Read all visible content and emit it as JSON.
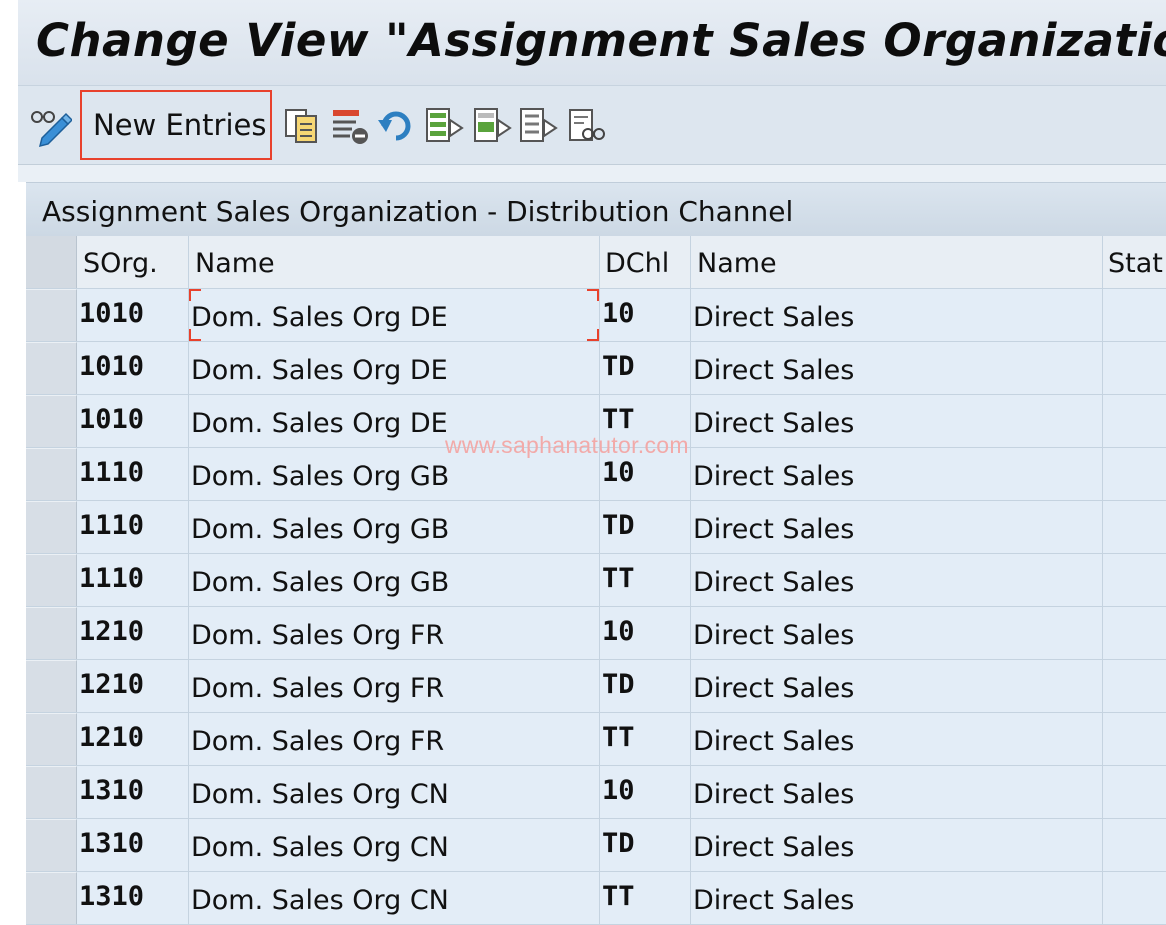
{
  "window": {
    "title": "Change View \"Assignment Sales Organization - Distribution Channel\": Overview"
  },
  "toolbar": {
    "new_entries_label": "New Entries",
    "icons": [
      "display-change-icon",
      "copy-as-icon",
      "delete-icon",
      "undo-change-icon",
      "select-all-icon",
      "select-block-icon",
      "deselect-all-icon",
      "print-icon"
    ]
  },
  "panel": {
    "title": "Assignment Sales Organization - Distribution Channel"
  },
  "table": {
    "columns": [
      "SOrg.",
      "Name",
      "DChl",
      "Name",
      "Stat"
    ],
    "rows": [
      {
        "sorg": "1010",
        "name": "Dom. Sales Org DE",
        "dchl": "10",
        "dname": "Direct Sales"
      },
      {
        "sorg": "1010",
        "name": "Dom. Sales Org DE",
        "dchl": "TD",
        "dname": "Direct Sales"
      },
      {
        "sorg": "1010",
        "name": "Dom. Sales Org DE",
        "dchl": "TT",
        "dname": "Direct Sales"
      },
      {
        "sorg": "1110",
        "name": "Dom. Sales Org GB",
        "dchl": "10",
        "dname": "Direct Sales"
      },
      {
        "sorg": "1110",
        "name": "Dom. Sales Org GB",
        "dchl": "TD",
        "dname": "Direct Sales"
      },
      {
        "sorg": "1110",
        "name": "Dom. Sales Org GB",
        "dchl": "TT",
        "dname": "Direct Sales"
      },
      {
        "sorg": "1210",
        "name": "Dom. Sales Org FR",
        "dchl": "10",
        "dname": "Direct Sales"
      },
      {
        "sorg": "1210",
        "name": "Dom. Sales Org FR",
        "dchl": "TD",
        "dname": "Direct Sales"
      },
      {
        "sorg": "1210",
        "name": "Dom. Sales Org FR",
        "dchl": "TT",
        "dname": "Direct Sales"
      },
      {
        "sorg": "1310",
        "name": "Dom. Sales Org CN",
        "dchl": "10",
        "dname": "Direct Sales"
      },
      {
        "sorg": "1310",
        "name": "Dom. Sales Org CN",
        "dchl": "TD",
        "dname": "Direct Sales"
      },
      {
        "sorg": "1310",
        "name": "Dom. Sales Org CN",
        "dchl": "TT",
        "dname": "Direct Sales"
      }
    ]
  },
  "watermark": "www.saphanatutor.com",
  "colors": {
    "highlight": "#e8412c",
    "row_bg": "#e3edf7",
    "header_bg": "#e8eef4"
  }
}
